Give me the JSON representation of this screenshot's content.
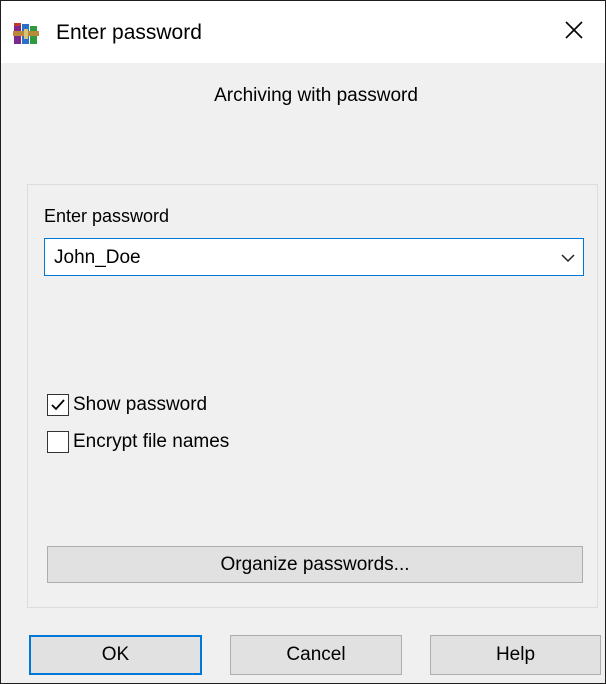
{
  "window": {
    "title": "Enter password",
    "app_icon": "winrar-books-icon",
    "close_icon": "close-icon"
  },
  "dialog": {
    "heading": "Archiving with password",
    "password_label": "Enter password",
    "password_value": "John_Doe",
    "dropdown_icon": "chevron-down-icon",
    "show_password": {
      "label": "Show password",
      "checked": true
    },
    "encrypt_names": {
      "label": "Encrypt file names",
      "checked": false
    },
    "organize_label": "Organize passwords..."
  },
  "buttons": {
    "ok": "OK",
    "cancel": "Cancel",
    "help": "Help"
  },
  "colors": {
    "accent": "#0078d7",
    "window_bg": "#f0f0f0",
    "button_bg": "#e1e1e1"
  }
}
